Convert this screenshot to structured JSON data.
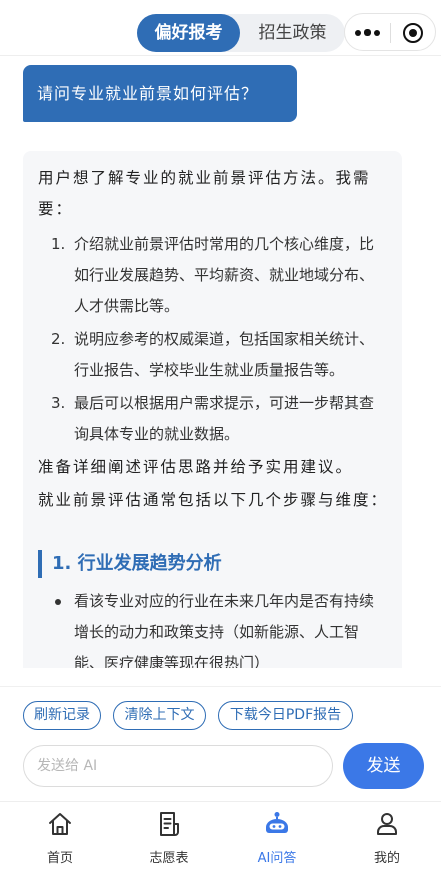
{
  "header": {
    "tabs": [
      {
        "label": "偏好报考",
        "active": true
      },
      {
        "label": "招生政策",
        "active": false
      }
    ],
    "more_icon": "more-dots-icon",
    "close_icon": "target-circle-icon"
  },
  "chat": {
    "user_message": "请问专业就业前景如何评估？",
    "ai_response": {
      "thinking_intro": "用户想了解专业的就业前景评估方法。我需要：",
      "thinking_steps": [
        {
          "num": "1.",
          "text": "介绍就业前景评估时常用的几个核心维度，比如行业发展趋势、平均薪资、就业地域分布、人才供需比等。"
        },
        {
          "num": "2.",
          "text": "说明应参考的权威渠道，包括国家相关统计、行业报告、学校毕业生就业质量报告等。"
        },
        {
          "num": "3.",
          "text": "最后可以根据用户需求提示，可进一步帮其查询具体专业的就业数据。"
        }
      ],
      "thinking_outro": "准备详细阐述评估思路并给予实用建议。",
      "answer_intro": "就业前景评估通常包括以下几个步骤与维度：",
      "section_title": "1. 行业发展趋势分析",
      "section_bullets": [
        "看该专业对应的行业在未来几年内是否有持续增长的动力和政策支持（如新能源、人工智能、医疗健康等现在很热门）"
      ]
    }
  },
  "quick_actions": [
    "刷新记录",
    "清除上下文",
    "下载今日PDF报告"
  ],
  "input": {
    "placeholder": "发送给 AI",
    "value": ""
  },
  "send_label": "发送",
  "tabbar": [
    {
      "label": "首页",
      "icon": "home-icon",
      "active": false
    },
    {
      "label": "志愿表",
      "icon": "document-icon",
      "active": false
    },
    {
      "label": "AI问答",
      "icon": "robot-icon",
      "active": true
    },
    {
      "label": "我的",
      "icon": "user-icon",
      "active": false
    }
  ],
  "colors": {
    "primary": "#2f6db5",
    "accent": "#3b78e7",
    "card_bg": "#f6f7f9"
  }
}
